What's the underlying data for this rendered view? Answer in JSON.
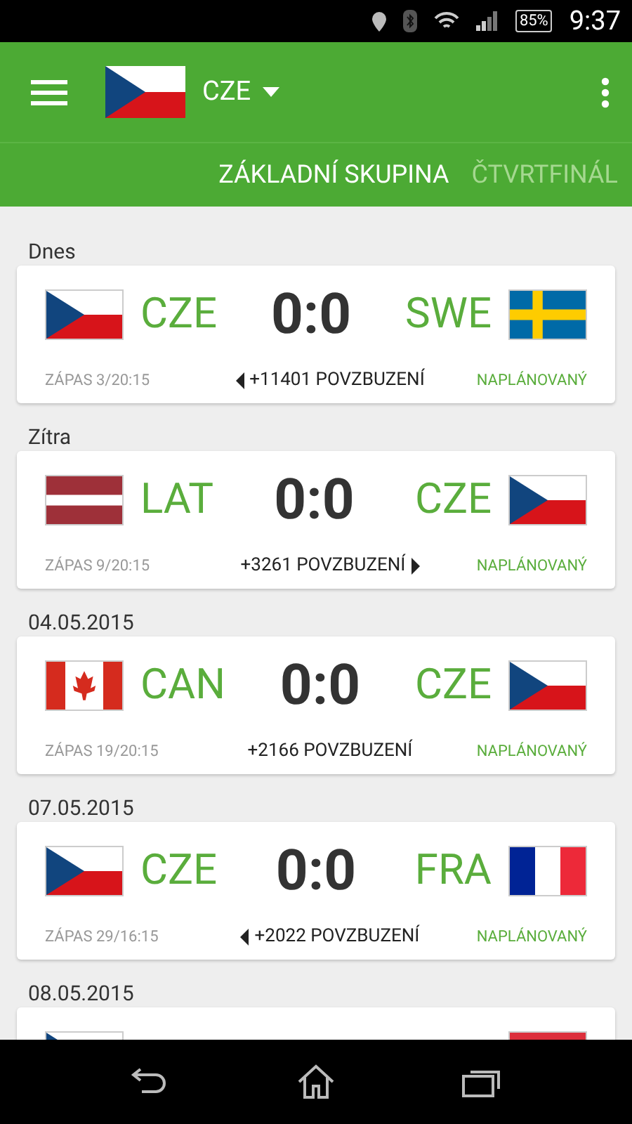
{
  "status_bar": {
    "battery": "85%",
    "time": "9:37"
  },
  "app_bar": {
    "team": "CZE",
    "flag": {
      "kind": "cze"
    }
  },
  "tabs": [
    {
      "label": "ZÁKLADNÍ SKUPINA",
      "selected": true
    },
    {
      "label": "ČTVRTFINÁL",
      "selected": false
    }
  ],
  "sections": [
    {
      "date": "Dnes",
      "match": {
        "home": {
          "code": "CZE",
          "flag": {
            "kind": "cze"
          }
        },
        "away": {
          "code": "SWE",
          "flag": {
            "kind": "swe"
          }
        },
        "score": "0:0",
        "info": "ZÁPAS 3/20:15",
        "cheers": "+11401 POVZBUZENÍ",
        "cheer_arrow": {
          "kind": "left"
        },
        "status": "NAPLÁNOVANÝ"
      }
    },
    {
      "date": "Zítra",
      "match": {
        "home": {
          "code": "LAT",
          "flag": {
            "kind": "lat"
          }
        },
        "away": {
          "code": "CZE",
          "flag": {
            "kind": "cze"
          }
        },
        "score": "0:0",
        "info": "ZÁPAS 9/20:15",
        "cheers": "+3261 POVZBUZENÍ",
        "cheer_arrow": {
          "kind": "right"
        },
        "status": "NAPLÁNOVANÝ"
      }
    },
    {
      "date": "04.05.2015",
      "match": {
        "home": {
          "code": "CAN",
          "flag": {
            "kind": "can"
          }
        },
        "away": {
          "code": "CZE",
          "flag": {
            "kind": "cze"
          }
        },
        "score": "0:0",
        "info": "ZÁPAS 19/20:15",
        "cheers": "+2166 POVZBUZENÍ",
        "status": "NAPLÁNOVANÝ"
      }
    },
    {
      "date": "07.05.2015",
      "match": {
        "home": {
          "code": "CZE",
          "flag": {
            "kind": "cze"
          }
        },
        "away": {
          "code": "FRA",
          "flag": {
            "kind": "fra"
          }
        },
        "score": "0:0",
        "info": "ZÁPAS 29/16:15",
        "cheers": "+2022 POVZBUZENÍ",
        "cheer_arrow": {
          "kind": "left"
        },
        "status": "NAPLÁNOVANÝ"
      }
    },
    {
      "date": "08.05.2015",
      "match": {
        "home": {
          "flag": {
            "kind": "cze"
          }
        },
        "away": {
          "flag": {
            "kind": "red"
          }
        }
      }
    }
  ]
}
